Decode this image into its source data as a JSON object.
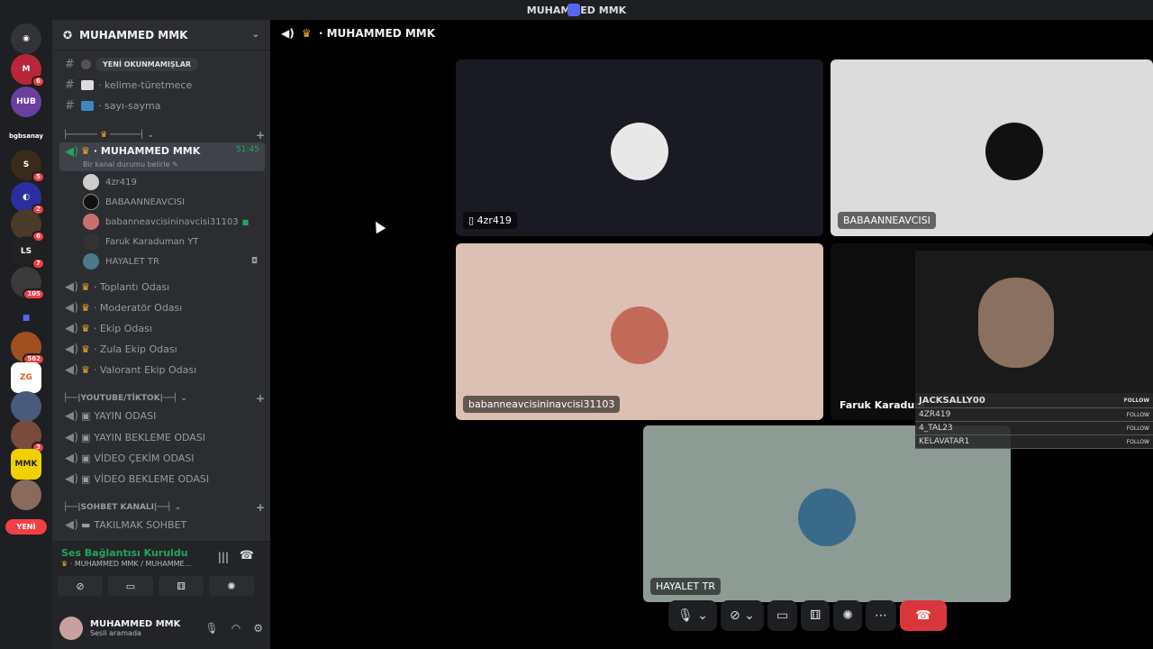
{
  "window_title": "MUHAMMED MMK",
  "server": {
    "name": "MUHAMMED MMK"
  },
  "unread_pill": "YENİ OKUNMAMIŞLAR",
  "channels": {
    "kelime": "· kelime-türetmece",
    "sayi": "· sayı-sayma"
  },
  "voice_active": {
    "name": "· MUHAMMED MMK",
    "time": "51:45",
    "status": "Bir kanal durumu belirle"
  },
  "voice_users": [
    "4zr419",
    "BABAANNEAVCISI",
    "babanneavcisininavcisi31103",
    "Faruk Karaduman YT",
    "HAYALET TR"
  ],
  "voice_channels": [
    "· Toplantı Odası",
    "· Moderatör Odası",
    "· Ekip Odası",
    "· Zula Ekip Odası",
    "· Valorant Ekip Odası"
  ],
  "categories": {
    "youtube": "|YOUTUBE/TİKTOK|",
    "sohbet": "|SOHBET KANALI|"
  },
  "yt_channels": [
    "YAYIN ODASI",
    "YAYIN BEKLEME ODASI",
    "VİDEO ÇEKİM ODASI",
    "VİDEO BEKLEME ODASI"
  ],
  "sohbet_channels": [
    "TAKILMAK SOHBET"
  ],
  "guild_badges": [
    "6",
    "5",
    "2",
    "6",
    "7",
    "105",
    "562",
    "3"
  ],
  "guild_labels": {
    "new": "YENİ",
    "bgbsanay": "bgbsanay"
  },
  "voice_panel": {
    "status": "Ses Bağlantısı Kuruldu",
    "sub": "MUHAMMED MMK / MUHAMME..."
  },
  "user_panel": {
    "name": "MUHAMMED MMK",
    "status": "Sesli aramada"
  },
  "main_header": "· MUHAMMED MMK",
  "tiles": {
    "t1": "4zr419",
    "t2": "BABAANNEAVCISI",
    "t3": "babanneavcisininavcisi31103",
    "t4": "Faruk Karadum",
    "t5": "HAYALET TR"
  },
  "overlay": {
    "rows": [
      "JACKSALLY00",
      "4ZR419",
      "4_TAL23",
      "KELAVATAR1"
    ],
    "follow": "FOLLOW"
  },
  "colors": {
    "accent": "#5865f2",
    "connected": "#23a55a",
    "hangup": "#da373c"
  }
}
